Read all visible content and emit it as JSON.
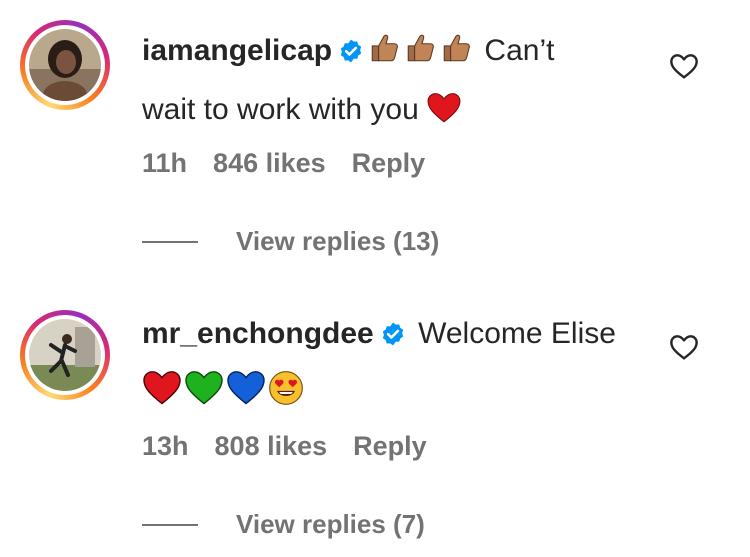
{
  "comments": [
    {
      "username": "iamangelicap",
      "verified": true,
      "text_line1": "Can’t",
      "text_line2": "wait to work with you",
      "emojis_before": [
        "thumbs-up-medium-skin",
        "thumbs-up-medium-skin",
        "thumbs-up-medium-skin"
      ],
      "emojis_after": [
        "red-heart"
      ],
      "time": "11h",
      "likes": "846 likes",
      "reply_label": "Reply",
      "view_replies": "View replies (13)",
      "like_icon": "heart-outline-icon"
    },
    {
      "username": "mr_enchongdee",
      "verified": true,
      "text_line1": "Welcome Elise",
      "emojis_line2": [
        "red-heart",
        "green-heart",
        "blue-heart",
        "smiling-face-with-heart-eyes"
      ],
      "time": "13h",
      "likes": "808 likes",
      "reply_label": "Reply",
      "view_replies": "View replies (7)",
      "like_icon": "heart-outline-icon"
    }
  ],
  "colors": {
    "text_primary": "#262626",
    "text_secondary": "#737373",
    "verified_blue": "#0095f6",
    "background": "#ffffff"
  }
}
